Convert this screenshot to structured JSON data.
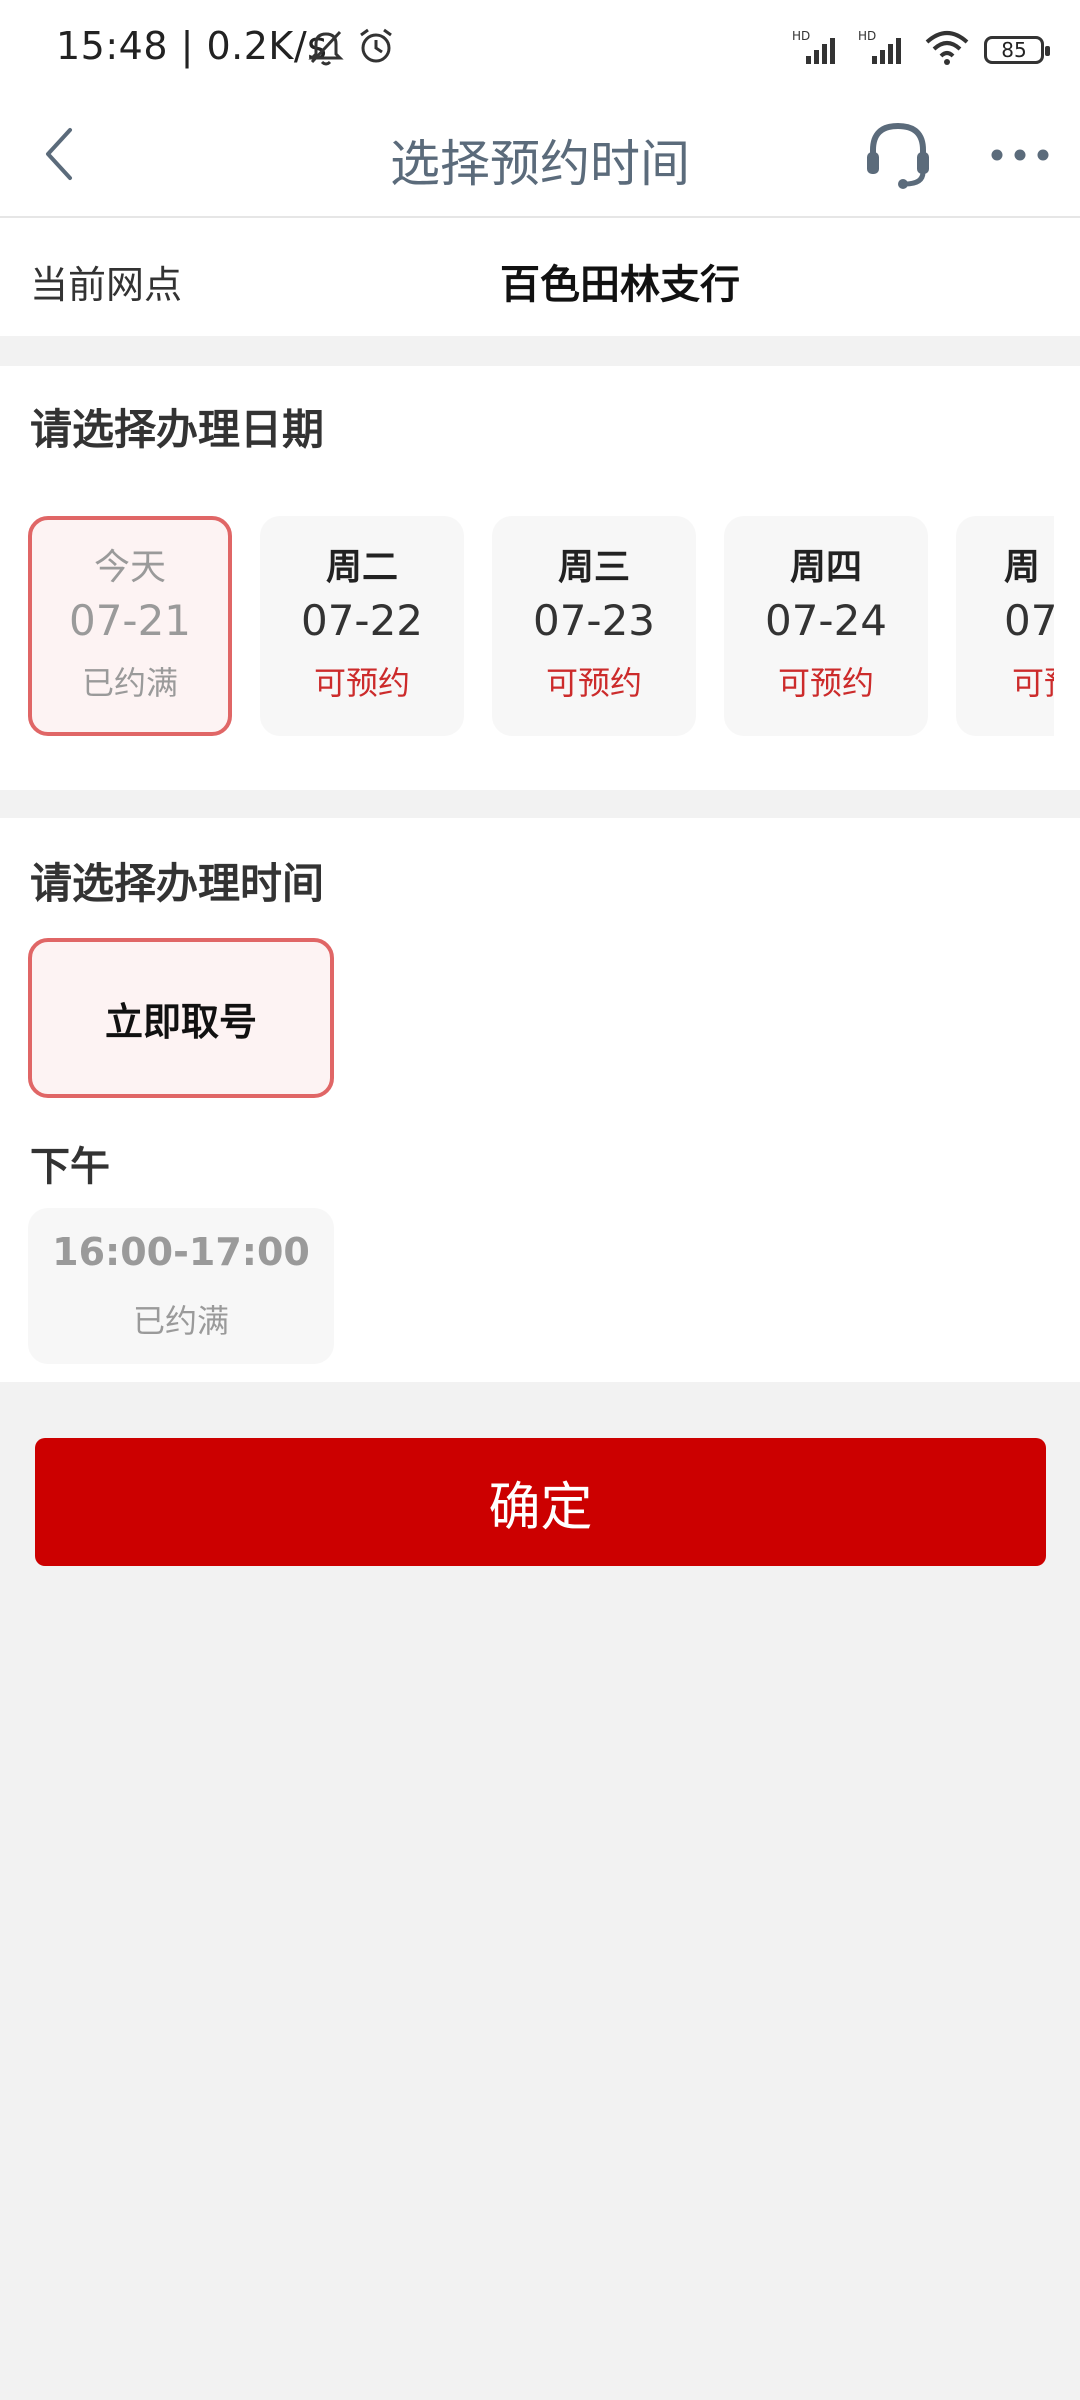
{
  "status_bar": {
    "time_speed": "15:48 | 0.2K/s",
    "icons": [
      "bell-off-icon",
      "alarm-icon",
      "signal-hd-icon",
      "signal-hd-icon",
      "wifi-icon"
    ],
    "battery": "85"
  },
  "header": {
    "title": "选择预约时间",
    "back_icon": "chevron-left-icon",
    "service_icon": "headset-icon",
    "more_icon": "more-dots-icon"
  },
  "branch": {
    "label": "当前网点",
    "value": "百色田林支行"
  },
  "date_section": {
    "title": "请选择办理日期",
    "dates": [
      {
        "weekday": "今天",
        "date": "07-21",
        "status": "已约满",
        "selected": true
      },
      {
        "weekday": "周二",
        "date": "07-22",
        "status": "可预约",
        "selected": false
      },
      {
        "weekday": "周三",
        "date": "07-23",
        "status": "可预约",
        "selected": false
      },
      {
        "weekday": "周四",
        "date": "07-24",
        "status": "可预约",
        "selected": false
      },
      {
        "weekday": "周",
        "date": "07-",
        "status": "可预",
        "selected": false
      }
    ]
  },
  "time_section": {
    "title": "请选择办理时间",
    "now_slot": "立即取号",
    "period": "下午",
    "slots": [
      {
        "time": "16:00-17:00",
        "status": "已约满"
      }
    ]
  },
  "confirm": {
    "label": "确定"
  },
  "colors": {
    "accent": "#cc0000",
    "selected_border": "#e06666",
    "available_text": "#cc2b2b"
  }
}
